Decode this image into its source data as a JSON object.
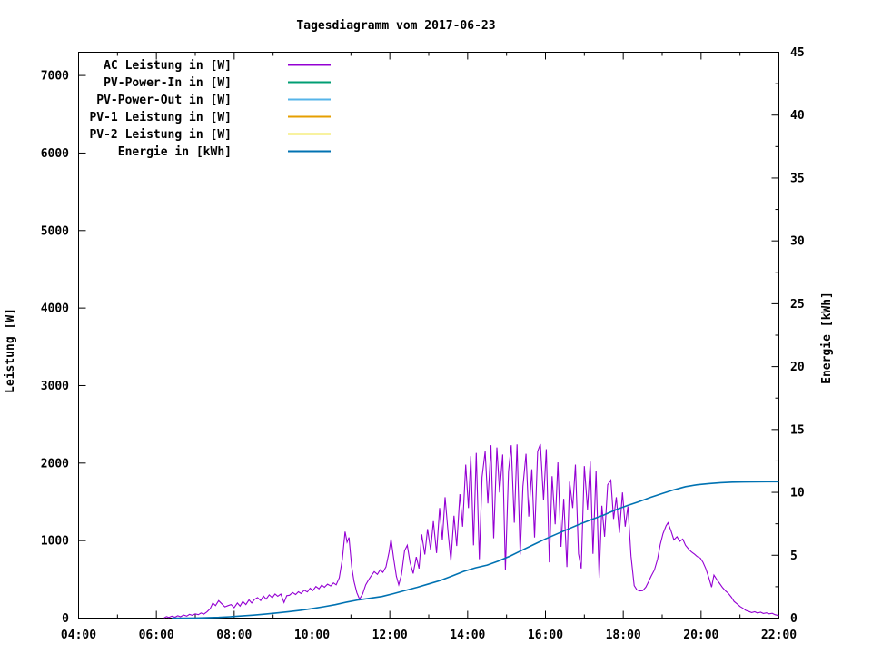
{
  "chart_data": {
    "type": "line",
    "title": "Tagesdiagramm vom 2017-06-23",
    "xlabel": "",
    "grid": false,
    "legend_position": "top-left-inside",
    "x_axis": {
      "range_hours": [
        4,
        22
      ],
      "major_step_hours": 2,
      "minor_step_hours": 1,
      "tick_labels": [
        "04:00",
        "06:00",
        "08:00",
        "10:00",
        "12:00",
        "14:00",
        "16:00",
        "18:00",
        "20:00",
        "22:00"
      ]
    },
    "y_left": {
      "label": "Leistung [W]",
      "range": [
        0,
        7300
      ],
      "tick_step": 1000,
      "tick_labels": [
        "0",
        "1000",
        "2000",
        "3000",
        "4000",
        "5000",
        "6000",
        "7000"
      ]
    },
    "y_right": {
      "label": "Energie [kWh]",
      "range": [
        0,
        45
      ],
      "tick_step": 5,
      "minor_step": 2.5,
      "tick_labels": [
        "0",
        "5",
        "10",
        "15",
        "20",
        "25",
        "30",
        "35",
        "40",
        "45"
      ]
    },
    "legend": [
      {
        "id": "ac-leistung",
        "label": "AC Leistung in [W]",
        "color": "#9400d3"
      },
      {
        "id": "pv-power-in",
        "label": "PV-Power-In in [W]",
        "color": "#009e73"
      },
      {
        "id": "pv-power-out",
        "label": "PV-Power-Out in [W]",
        "color": "#56b4e9"
      },
      {
        "id": "pv-1-leistung",
        "label": "PV-1 Leistung in [W]",
        "color": "#e69f00"
      },
      {
        "id": "pv-2-leistung",
        "label": "PV-2 Leistung in [W]",
        "color": "#f0e442"
      },
      {
        "id": "energie",
        "label": "Energie in [kWh]",
        "color": "#0072b2"
      }
    ],
    "series": [
      {
        "id": "ac-leistung",
        "name": "AC Leistung in [W]",
        "color": "#9400d3",
        "axis": "left",
        "width": 1.1,
        "points": [
          [
            6.2,
            4
          ],
          [
            6.26,
            20
          ],
          [
            6.32,
            8
          ],
          [
            6.4,
            26
          ],
          [
            6.48,
            12
          ],
          [
            6.55,
            30
          ],
          [
            6.62,
            18
          ],
          [
            6.7,
            40
          ],
          [
            6.78,
            26
          ],
          [
            6.85,
            48
          ],
          [
            6.92,
            36
          ],
          [
            7.0,
            55
          ],
          [
            7.08,
            44
          ],
          [
            7.15,
            66
          ],
          [
            7.22,
            52
          ],
          [
            7.3,
            80
          ],
          [
            7.38,
            120
          ],
          [
            7.45,
            195
          ],
          [
            7.52,
            160
          ],
          [
            7.6,
            225
          ],
          [
            7.68,
            185
          ],
          [
            7.76,
            145
          ],
          [
            7.84,
            160
          ],
          [
            7.92,
            175
          ],
          [
            8.0,
            135
          ],
          [
            8.08,
            195
          ],
          [
            8.15,
            155
          ],
          [
            8.22,
            215
          ],
          [
            8.3,
            175
          ],
          [
            8.38,
            235
          ],
          [
            8.45,
            195
          ],
          [
            8.52,
            240
          ],
          [
            8.6,
            265
          ],
          [
            8.68,
            225
          ],
          [
            8.75,
            285
          ],
          [
            8.82,
            245
          ],
          [
            8.9,
            300
          ],
          [
            8.98,
            262
          ],
          [
            9.05,
            312
          ],
          [
            9.12,
            282
          ],
          [
            9.2,
            310
          ],
          [
            9.28,
            200
          ],
          [
            9.35,
            290
          ],
          [
            9.42,
            295
          ],
          [
            9.5,
            330
          ],
          [
            9.58,
            305
          ],
          [
            9.65,
            340
          ],
          [
            9.72,
            318
          ],
          [
            9.8,
            360
          ],
          [
            9.88,
            338
          ],
          [
            9.95,
            385
          ],
          [
            10.02,
            355
          ],
          [
            10.1,
            408
          ],
          [
            10.18,
            378
          ],
          [
            10.25,
            428
          ],
          [
            10.32,
            398
          ],
          [
            10.4,
            438
          ],
          [
            10.48,
            415
          ],
          [
            10.55,
            455
          ],
          [
            10.62,
            430
          ],
          [
            10.7,
            520
          ],
          [
            10.78,
            760
          ],
          [
            10.85,
            1115
          ],
          [
            10.9,
            980
          ],
          [
            10.95,
            1040
          ],
          [
            11.02,
            660
          ],
          [
            11.08,
            470
          ],
          [
            11.15,
            330
          ],
          [
            11.22,
            245
          ],
          [
            11.3,
            310
          ],
          [
            11.38,
            430
          ],
          [
            11.45,
            490
          ],
          [
            11.52,
            545
          ],
          [
            11.6,
            600
          ],
          [
            11.68,
            565
          ],
          [
            11.75,
            625
          ],
          [
            11.82,
            590
          ],
          [
            11.9,
            660
          ],
          [
            11.98,
            850
          ],
          [
            12.03,
            1020
          ],
          [
            12.1,
            770
          ],
          [
            12.17,
            540
          ],
          [
            12.23,
            430
          ],
          [
            12.3,
            560
          ],
          [
            12.38,
            870
          ],
          [
            12.45,
            940
          ],
          [
            12.52,
            720
          ],
          [
            12.6,
            575
          ],
          [
            12.68,
            790
          ],
          [
            12.75,
            640
          ],
          [
            12.82,
            1080
          ],
          [
            12.9,
            820
          ],
          [
            12.97,
            1150
          ],
          [
            13.05,
            880
          ],
          [
            13.12,
            1250
          ],
          [
            13.2,
            840
          ],
          [
            13.28,
            1420
          ],
          [
            13.35,
            1010
          ],
          [
            13.42,
            1560
          ],
          [
            13.5,
            1090
          ],
          [
            13.57,
            740
          ],
          [
            13.65,
            1320
          ],
          [
            13.72,
            930
          ],
          [
            13.8,
            1600
          ],
          [
            13.87,
            1180
          ],
          [
            13.95,
            1980
          ],
          [
            14.02,
            1420
          ],
          [
            14.08,
            2090
          ],
          [
            14.15,
            940
          ],
          [
            14.22,
            2130
          ],
          [
            14.3,
            760
          ],
          [
            14.37,
            1820
          ],
          [
            14.45,
            2150
          ],
          [
            14.52,
            1480
          ],
          [
            14.6,
            2230
          ],
          [
            14.67,
            1030
          ],
          [
            14.75,
            2200
          ],
          [
            14.82,
            1620
          ],
          [
            14.9,
            2110
          ],
          [
            14.97,
            620
          ],
          [
            15.05,
            1890
          ],
          [
            15.12,
            2230
          ],
          [
            15.2,
            1230
          ],
          [
            15.27,
            2240
          ],
          [
            15.35,
            820
          ],
          [
            15.42,
            1700
          ],
          [
            15.5,
            2120
          ],
          [
            15.57,
            1310
          ],
          [
            15.65,
            1920
          ],
          [
            15.72,
            1040
          ],
          [
            15.8,
            2150
          ],
          [
            15.87,
            2245
          ],
          [
            15.95,
            1520
          ],
          [
            16.02,
            2180
          ],
          [
            16.1,
            720
          ],
          [
            16.17,
            1830
          ],
          [
            16.25,
            1210
          ],
          [
            16.32,
            2010
          ],
          [
            16.4,
            920
          ],
          [
            16.47,
            1540
          ],
          [
            16.55,
            660
          ],
          [
            16.62,
            1760
          ],
          [
            16.7,
            1420
          ],
          [
            16.77,
            1980
          ],
          [
            16.85,
            830
          ],
          [
            16.92,
            640
          ],
          [
            17.0,
            1960
          ],
          [
            17.08,
            1400
          ],
          [
            17.15,
            2020
          ],
          [
            17.22,
            830
          ],
          [
            17.3,
            1900
          ],
          [
            17.38,
            520
          ],
          [
            17.45,
            1450
          ],
          [
            17.52,
            1050
          ],
          [
            17.6,
            1720
          ],
          [
            17.68,
            1780
          ],
          [
            17.75,
            1280
          ],
          [
            17.82,
            1560
          ],
          [
            17.9,
            1100
          ],
          [
            17.98,
            1620
          ],
          [
            18.05,
            1180
          ],
          [
            18.12,
            1440
          ],
          [
            18.2,
            800
          ],
          [
            18.28,
            420
          ],
          [
            18.35,
            365
          ],
          [
            18.43,
            350
          ],
          [
            18.5,
            355
          ],
          [
            18.58,
            400
          ],
          [
            18.65,
            470
          ],
          [
            18.72,
            545
          ],
          [
            18.8,
            620
          ],
          [
            18.88,
            760
          ],
          [
            18.95,
            950
          ],
          [
            19.02,
            1090
          ],
          [
            19.1,
            1190
          ],
          [
            19.15,
            1230
          ],
          [
            19.23,
            1120
          ],
          [
            19.3,
            1010
          ],
          [
            19.38,
            1050
          ],
          [
            19.45,
            990
          ],
          [
            19.53,
            1020
          ],
          [
            19.6,
            940
          ],
          [
            19.68,
            890
          ],
          [
            19.75,
            855
          ],
          [
            19.83,
            825
          ],
          [
            19.9,
            795
          ],
          [
            19.98,
            775
          ],
          [
            20.05,
            720
          ],
          [
            20.12,
            640
          ],
          [
            20.2,
            520
          ],
          [
            20.27,
            400
          ],
          [
            20.33,
            555
          ],
          [
            20.4,
            500
          ],
          [
            20.48,
            445
          ],
          [
            20.55,
            395
          ],
          [
            20.63,
            350
          ],
          [
            20.7,
            320
          ],
          [
            20.78,
            270
          ],
          [
            20.85,
            215
          ],
          [
            20.93,
            180
          ],
          [
            21.0,
            150
          ],
          [
            21.08,
            125
          ],
          [
            21.15,
            100
          ],
          [
            21.23,
            85
          ],
          [
            21.3,
            72
          ],
          [
            21.38,
            82
          ],
          [
            21.45,
            66
          ],
          [
            21.53,
            76
          ],
          [
            21.6,
            60
          ],
          [
            21.68,
            68
          ],
          [
            21.75,
            55
          ],
          [
            21.83,
            62
          ],
          [
            21.9,
            45
          ],
          [
            22.0,
            32
          ]
        ]
      },
      {
        "id": "pv-power-in",
        "name": "PV-Power-In in [W]",
        "color": "#009e73",
        "axis": "left",
        "width": 1.1,
        "points": []
      },
      {
        "id": "pv-power-out",
        "name": "PV-Power-Out in [W]",
        "color": "#56b4e9",
        "axis": "left",
        "width": 1.1,
        "points": []
      },
      {
        "id": "pv-1-leistung",
        "name": "PV-1 Leistung in [W]",
        "color": "#e69f00",
        "axis": "left",
        "width": 1.1,
        "points": []
      },
      {
        "id": "pv-2-leistung",
        "name": "PV-2 Leistung in [W]",
        "color": "#f0e442",
        "axis": "left",
        "width": 1.1,
        "points": []
      },
      {
        "id": "energie",
        "name": "Energie in [kWh]",
        "color": "#0072b2",
        "axis": "right",
        "width": 1.6,
        "points": [
          [
            6.4,
            0
          ],
          [
            6.7,
            0
          ],
          [
            7.0,
            0.01
          ],
          [
            7.3,
            0.03
          ],
          [
            7.6,
            0.06
          ],
          [
            7.9,
            0.11
          ],
          [
            8.2,
            0.17
          ],
          [
            8.5,
            0.24
          ],
          [
            8.8,
            0.32
          ],
          [
            9.1,
            0.41
          ],
          [
            9.4,
            0.51
          ],
          [
            9.7,
            0.62
          ],
          [
            10.0,
            0.75
          ],
          [
            10.3,
            0.9
          ],
          [
            10.6,
            1.07
          ],
          [
            10.9,
            1.28
          ],
          [
            11.2,
            1.45
          ],
          [
            11.5,
            1.58
          ],
          [
            11.8,
            1.72
          ],
          [
            12.1,
            1.95
          ],
          [
            12.4,
            2.2
          ],
          [
            12.7,
            2.45
          ],
          [
            13.0,
            2.72
          ],
          [
            13.3,
            3.0
          ],
          [
            13.6,
            3.35
          ],
          [
            13.9,
            3.72
          ],
          [
            14.2,
            4.0
          ],
          [
            14.5,
            4.22
          ],
          [
            14.8,
            4.55
          ],
          [
            15.1,
            4.95
          ],
          [
            15.4,
            5.4
          ],
          [
            15.7,
            5.85
          ],
          [
            16.0,
            6.3
          ],
          [
            16.3,
            6.7
          ],
          [
            16.6,
            7.1
          ],
          [
            16.9,
            7.5
          ],
          [
            17.2,
            7.85
          ],
          [
            17.5,
            8.2
          ],
          [
            17.8,
            8.6
          ],
          [
            18.1,
            8.95
          ],
          [
            18.4,
            9.25
          ],
          [
            18.7,
            9.6
          ],
          [
            19.0,
            9.9
          ],
          [
            19.3,
            10.2
          ],
          [
            19.6,
            10.45
          ],
          [
            19.9,
            10.6
          ],
          [
            20.2,
            10.7
          ],
          [
            20.5,
            10.77
          ],
          [
            20.8,
            10.81
          ],
          [
            21.1,
            10.83
          ],
          [
            21.4,
            10.84
          ],
          [
            21.7,
            10.85
          ],
          [
            22.0,
            10.85
          ]
        ]
      }
    ]
  }
}
